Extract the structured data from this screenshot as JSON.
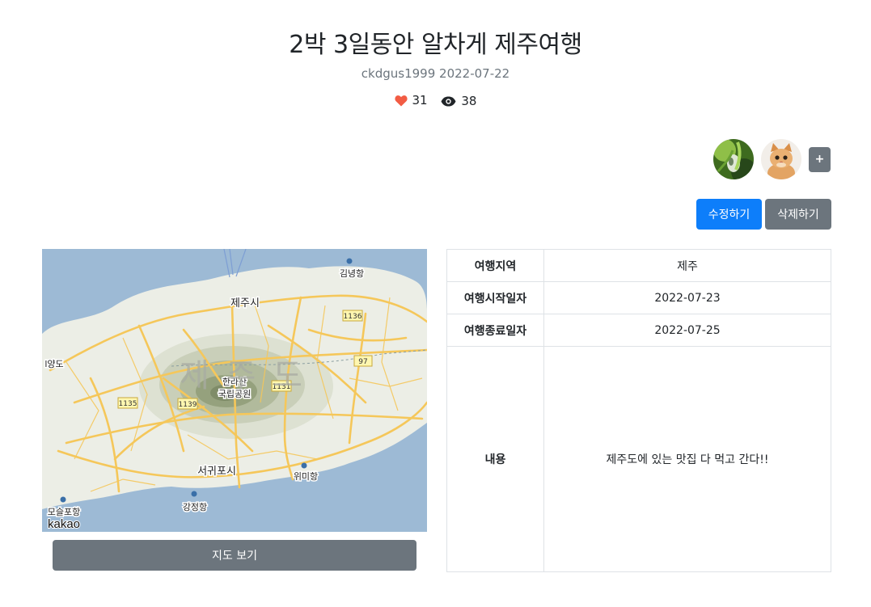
{
  "post": {
    "title": "2박 3일동안 알차게 제주여행",
    "author": "ckdgus1999",
    "date": "2022-07-22",
    "likes": "31",
    "views": "38"
  },
  "participants": {
    "avatars": [
      "avatar-plant",
      "avatar-kitten"
    ],
    "add_label": "+"
  },
  "actions": {
    "edit_label": "수정하기",
    "delete_label": "삭제하기"
  },
  "map": {
    "button_label": "지도 보기",
    "labels": {
      "jeju_city": "제주시",
      "gimnyeong_port": "김녕항",
      "island_name": "제 주 도",
      "hallasan": "한라산",
      "national_park": "국립공원",
      "seogwipo": "서귀포시",
      "wimi_port": "위미항",
      "gangjeong_port": "강정항",
      "moseulpo_port": "모슬포항",
      "west_town": "l양도",
      "road_1136": "1136",
      "road_97": "97",
      "road_1131": "1131",
      "road_1135": "1135",
      "road_1139": "1139",
      "provider": "kakao"
    }
  },
  "details": {
    "rows": [
      {
        "label": "여행지역",
        "value": "제주"
      },
      {
        "label": "여행시작일자",
        "value": "2022-07-23"
      },
      {
        "label": "여행종료일자",
        "value": "2022-07-25"
      },
      {
        "label": "내용",
        "value": "제주도에 있는 맛집 다 먹고 간다!!"
      }
    ]
  },
  "colors": {
    "primary": "#0d7efa",
    "secondary": "#6c757d",
    "heart": "#f25c44",
    "sea": "#9dbad5",
    "land": "#eceee6",
    "road": "#f5c75a"
  }
}
